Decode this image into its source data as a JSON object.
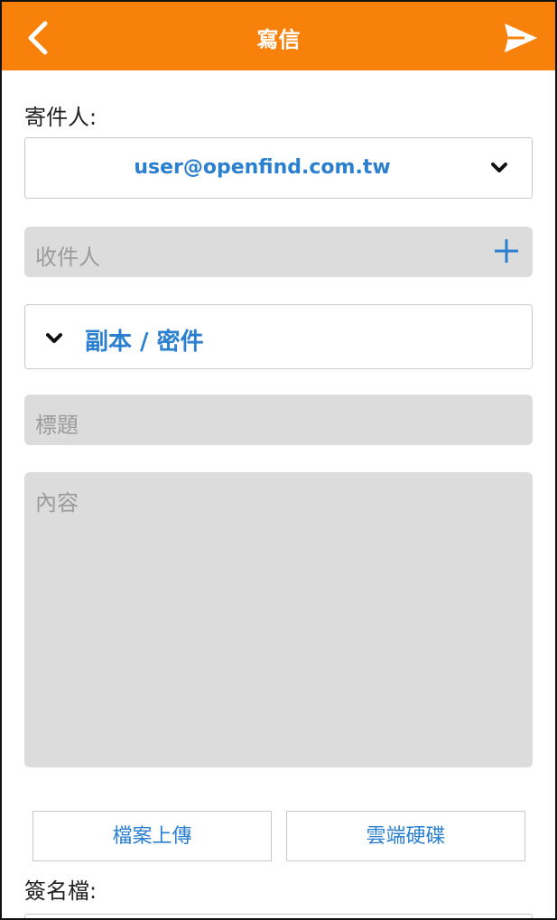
{
  "header": {
    "title": "寫信",
    "back_icon": "chevron-left-icon",
    "send_icon": "paper-plane-send-icon"
  },
  "form": {
    "sender_label": "寄件人:",
    "sender_value": "user@openfind.com.tw",
    "recipient_placeholder": "收件人",
    "cc_bcc_label": "副本 / 密件",
    "subject_placeholder": "標題",
    "body_placeholder": "內容",
    "signature_label": "簽名檔:"
  },
  "buttons": {
    "upload_label": "檔案上傳",
    "cloud_label": "雲端硬碟"
  },
  "colors": {
    "header_bg": "#f7810a",
    "accent": "#2a7fcf",
    "field_bg": "#dcdcdc"
  }
}
